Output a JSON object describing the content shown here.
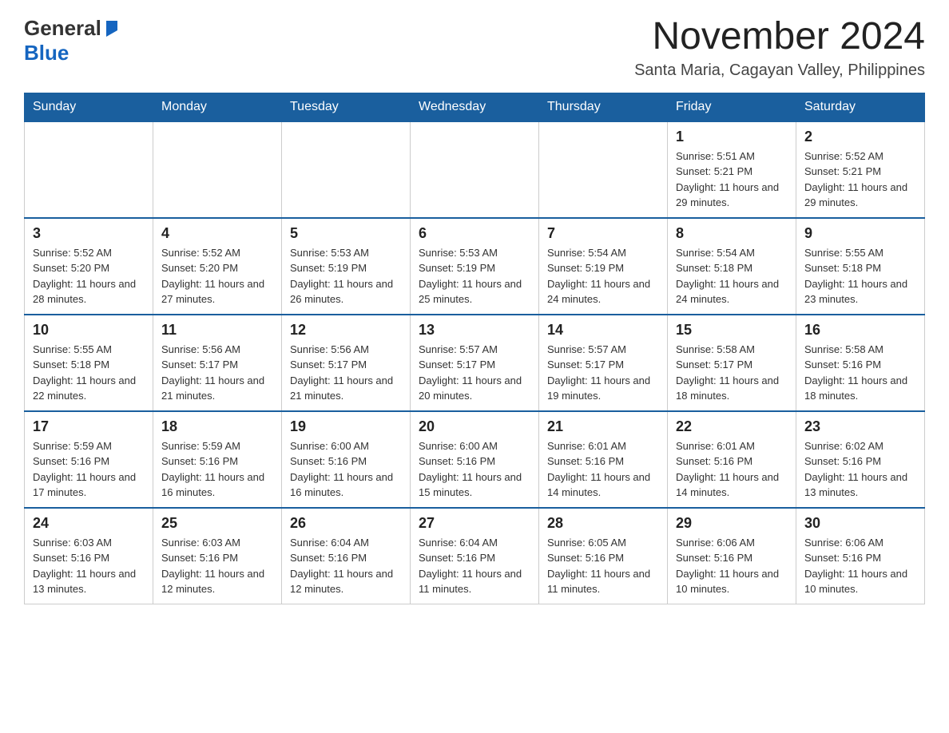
{
  "header": {
    "logo_general": "General",
    "logo_blue": "Blue",
    "main_title": "November 2024",
    "subtitle": "Santa Maria, Cagayan Valley, Philippines"
  },
  "calendar": {
    "days_of_week": [
      "Sunday",
      "Monday",
      "Tuesday",
      "Wednesday",
      "Thursday",
      "Friday",
      "Saturday"
    ],
    "weeks": [
      [
        {
          "day": "",
          "info": ""
        },
        {
          "day": "",
          "info": ""
        },
        {
          "day": "",
          "info": ""
        },
        {
          "day": "",
          "info": ""
        },
        {
          "day": "",
          "info": ""
        },
        {
          "day": "1",
          "info": "Sunrise: 5:51 AM\nSunset: 5:21 PM\nDaylight: 11 hours and 29 minutes."
        },
        {
          "day": "2",
          "info": "Sunrise: 5:52 AM\nSunset: 5:21 PM\nDaylight: 11 hours and 29 minutes."
        }
      ],
      [
        {
          "day": "3",
          "info": "Sunrise: 5:52 AM\nSunset: 5:20 PM\nDaylight: 11 hours and 28 minutes."
        },
        {
          "day": "4",
          "info": "Sunrise: 5:52 AM\nSunset: 5:20 PM\nDaylight: 11 hours and 27 minutes."
        },
        {
          "day": "5",
          "info": "Sunrise: 5:53 AM\nSunset: 5:19 PM\nDaylight: 11 hours and 26 minutes."
        },
        {
          "day": "6",
          "info": "Sunrise: 5:53 AM\nSunset: 5:19 PM\nDaylight: 11 hours and 25 minutes."
        },
        {
          "day": "7",
          "info": "Sunrise: 5:54 AM\nSunset: 5:19 PM\nDaylight: 11 hours and 24 minutes."
        },
        {
          "day": "8",
          "info": "Sunrise: 5:54 AM\nSunset: 5:18 PM\nDaylight: 11 hours and 24 minutes."
        },
        {
          "day": "9",
          "info": "Sunrise: 5:55 AM\nSunset: 5:18 PM\nDaylight: 11 hours and 23 minutes."
        }
      ],
      [
        {
          "day": "10",
          "info": "Sunrise: 5:55 AM\nSunset: 5:18 PM\nDaylight: 11 hours and 22 minutes."
        },
        {
          "day": "11",
          "info": "Sunrise: 5:56 AM\nSunset: 5:17 PM\nDaylight: 11 hours and 21 minutes."
        },
        {
          "day": "12",
          "info": "Sunrise: 5:56 AM\nSunset: 5:17 PM\nDaylight: 11 hours and 21 minutes."
        },
        {
          "day": "13",
          "info": "Sunrise: 5:57 AM\nSunset: 5:17 PM\nDaylight: 11 hours and 20 minutes."
        },
        {
          "day": "14",
          "info": "Sunrise: 5:57 AM\nSunset: 5:17 PM\nDaylight: 11 hours and 19 minutes."
        },
        {
          "day": "15",
          "info": "Sunrise: 5:58 AM\nSunset: 5:17 PM\nDaylight: 11 hours and 18 minutes."
        },
        {
          "day": "16",
          "info": "Sunrise: 5:58 AM\nSunset: 5:16 PM\nDaylight: 11 hours and 18 minutes."
        }
      ],
      [
        {
          "day": "17",
          "info": "Sunrise: 5:59 AM\nSunset: 5:16 PM\nDaylight: 11 hours and 17 minutes."
        },
        {
          "day": "18",
          "info": "Sunrise: 5:59 AM\nSunset: 5:16 PM\nDaylight: 11 hours and 16 minutes."
        },
        {
          "day": "19",
          "info": "Sunrise: 6:00 AM\nSunset: 5:16 PM\nDaylight: 11 hours and 16 minutes."
        },
        {
          "day": "20",
          "info": "Sunrise: 6:00 AM\nSunset: 5:16 PM\nDaylight: 11 hours and 15 minutes."
        },
        {
          "day": "21",
          "info": "Sunrise: 6:01 AM\nSunset: 5:16 PM\nDaylight: 11 hours and 14 minutes."
        },
        {
          "day": "22",
          "info": "Sunrise: 6:01 AM\nSunset: 5:16 PM\nDaylight: 11 hours and 14 minutes."
        },
        {
          "day": "23",
          "info": "Sunrise: 6:02 AM\nSunset: 5:16 PM\nDaylight: 11 hours and 13 minutes."
        }
      ],
      [
        {
          "day": "24",
          "info": "Sunrise: 6:03 AM\nSunset: 5:16 PM\nDaylight: 11 hours and 13 minutes."
        },
        {
          "day": "25",
          "info": "Sunrise: 6:03 AM\nSunset: 5:16 PM\nDaylight: 11 hours and 12 minutes."
        },
        {
          "day": "26",
          "info": "Sunrise: 6:04 AM\nSunset: 5:16 PM\nDaylight: 11 hours and 12 minutes."
        },
        {
          "day": "27",
          "info": "Sunrise: 6:04 AM\nSunset: 5:16 PM\nDaylight: 11 hours and 11 minutes."
        },
        {
          "day": "28",
          "info": "Sunrise: 6:05 AM\nSunset: 5:16 PM\nDaylight: 11 hours and 11 minutes."
        },
        {
          "day": "29",
          "info": "Sunrise: 6:06 AM\nSunset: 5:16 PM\nDaylight: 11 hours and 10 minutes."
        },
        {
          "day": "30",
          "info": "Sunrise: 6:06 AM\nSunset: 5:16 PM\nDaylight: 11 hours and 10 minutes."
        }
      ]
    ]
  }
}
